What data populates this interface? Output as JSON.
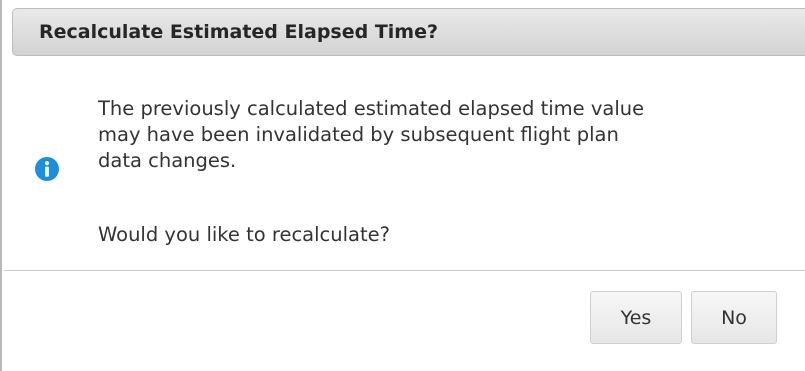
{
  "dialog": {
    "title": "Recalculate Estimated Elapsed Time?",
    "message_lines": [
      "The previously calculated estimated elapsed time value",
      "may have been invalidated by subsequent flight plan",
      "data changes."
    ],
    "question": "Would you like to recalculate?",
    "icon": "info-icon",
    "accent_color": "#1a8ee0",
    "buttons": {
      "yes_label": "Yes",
      "no_label": "No"
    }
  }
}
